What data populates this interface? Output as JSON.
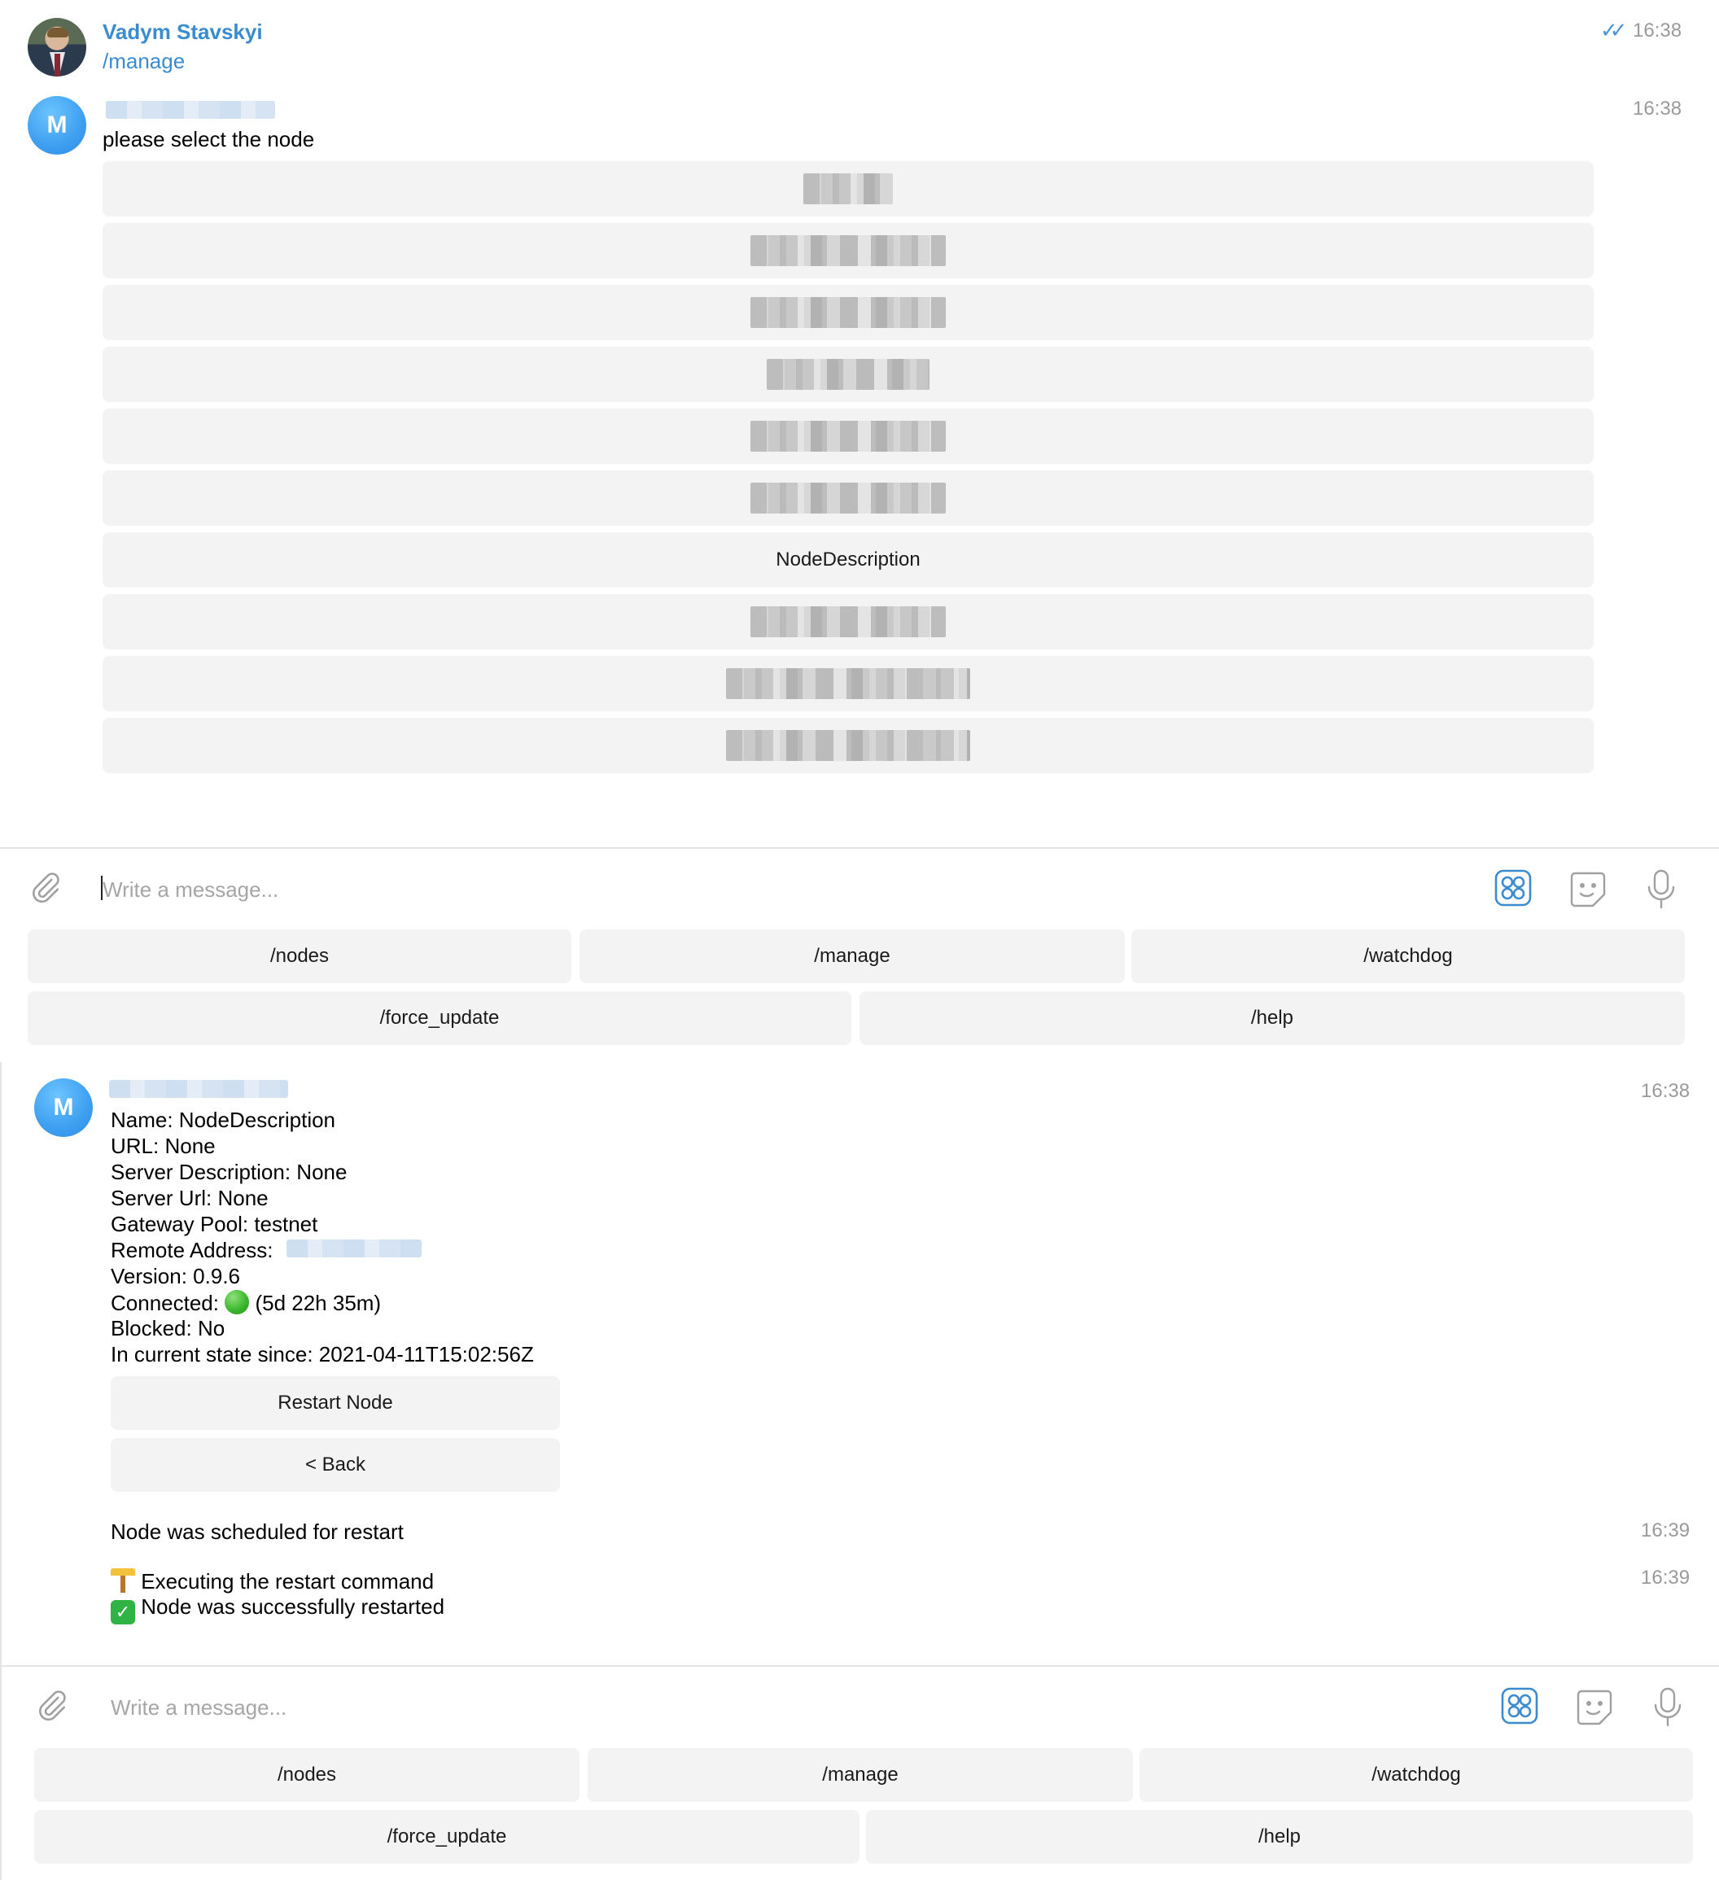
{
  "panel1": {
    "msg1": {
      "sender": "Vadym Stavskyi",
      "text": "/manage",
      "time": "16:38",
      "status": "read"
    },
    "msg2": {
      "avatar_letter": "M",
      "time": "16:38",
      "text": "please select the node",
      "buttons": [
        "",
        "",
        "",
        "",
        "",
        "",
        "NodeDescription",
        "",
        "",
        ""
      ]
    },
    "composer": {
      "placeholder": "Write a message..."
    },
    "keyboard": {
      "row1": [
        "/nodes",
        "/manage",
        "/watchdog"
      ],
      "row2": [
        "/force_update",
        "/help"
      ]
    }
  },
  "panel2": {
    "msg": {
      "avatar_letter": "M",
      "time": "16:38",
      "lines": {
        "name": "Name: NodeDescription",
        "url": "URL: None",
        "server_description": "Server Description: None",
        "server_url": "Server Url: None",
        "gateway_pool": "Gateway Pool: testnet",
        "remote_address": "Remote Address:",
        "version": "Version: 0.9.6",
        "connected_label": "Connected:",
        "connected_duration": "(5d 22h 35m)",
        "blocked": "Blocked: No",
        "state_since": "In current state since: 2021-04-11T15:02:56Z"
      },
      "buttons": [
        "Restart Node",
        "< Back"
      ]
    },
    "msg_scheduled": {
      "text": "Node was scheduled for restart",
      "time": "16:39"
    },
    "msg_result": {
      "line1": "Executing the restart command",
      "line2": "Node was successfully restarted",
      "time": "16:39"
    },
    "composer": {
      "placeholder": "Write a message..."
    },
    "keyboard": {
      "row1": [
        "/nodes",
        "/manage",
        "/watchdog"
      ],
      "row2": [
        "/force_update",
        "/help"
      ]
    }
  },
  "icons": {
    "attach": "paperclip-icon",
    "commands": "bot-commands-icon",
    "sticker": "sticker-icon",
    "voice": "microphone-icon"
  },
  "colors": {
    "accent": "#3a8bd0",
    "avatar": "#3e9ff0",
    "button_bg": "#f3f3f3"
  }
}
